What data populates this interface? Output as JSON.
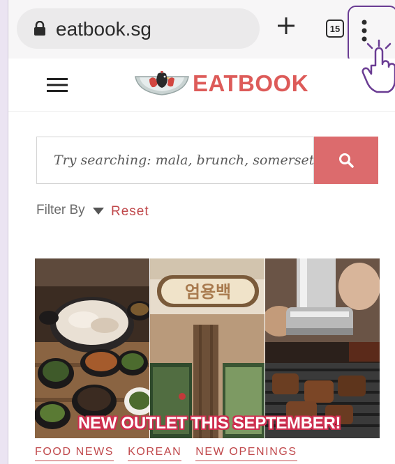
{
  "browser": {
    "url": "eatbook.sg",
    "tab_count": "15",
    "icons": [
      "lock-icon",
      "plus-icon",
      "tabs-icon",
      "kebab-menu-icon",
      "hand-pointer-icon"
    ]
  },
  "site": {
    "logo_text": "EATBOOK",
    "brand_color": "#dd5b59"
  },
  "search": {
    "placeholder": "Try searching: mala, brunch, somerset..",
    "button_color": "#dc6b6d"
  },
  "filter": {
    "label": "Filter By",
    "reset_label": "Reset"
  },
  "article": {
    "image_banner": "NEW OUTLET THIS SEPTEMBER!",
    "sign_text": "엄용백",
    "tags": [
      "FOOD NEWS",
      "KOREAN",
      "NEW OPENINGS"
    ]
  },
  "colors": {
    "accent": "#c0484b",
    "highlight_border": "#6a3c93"
  }
}
